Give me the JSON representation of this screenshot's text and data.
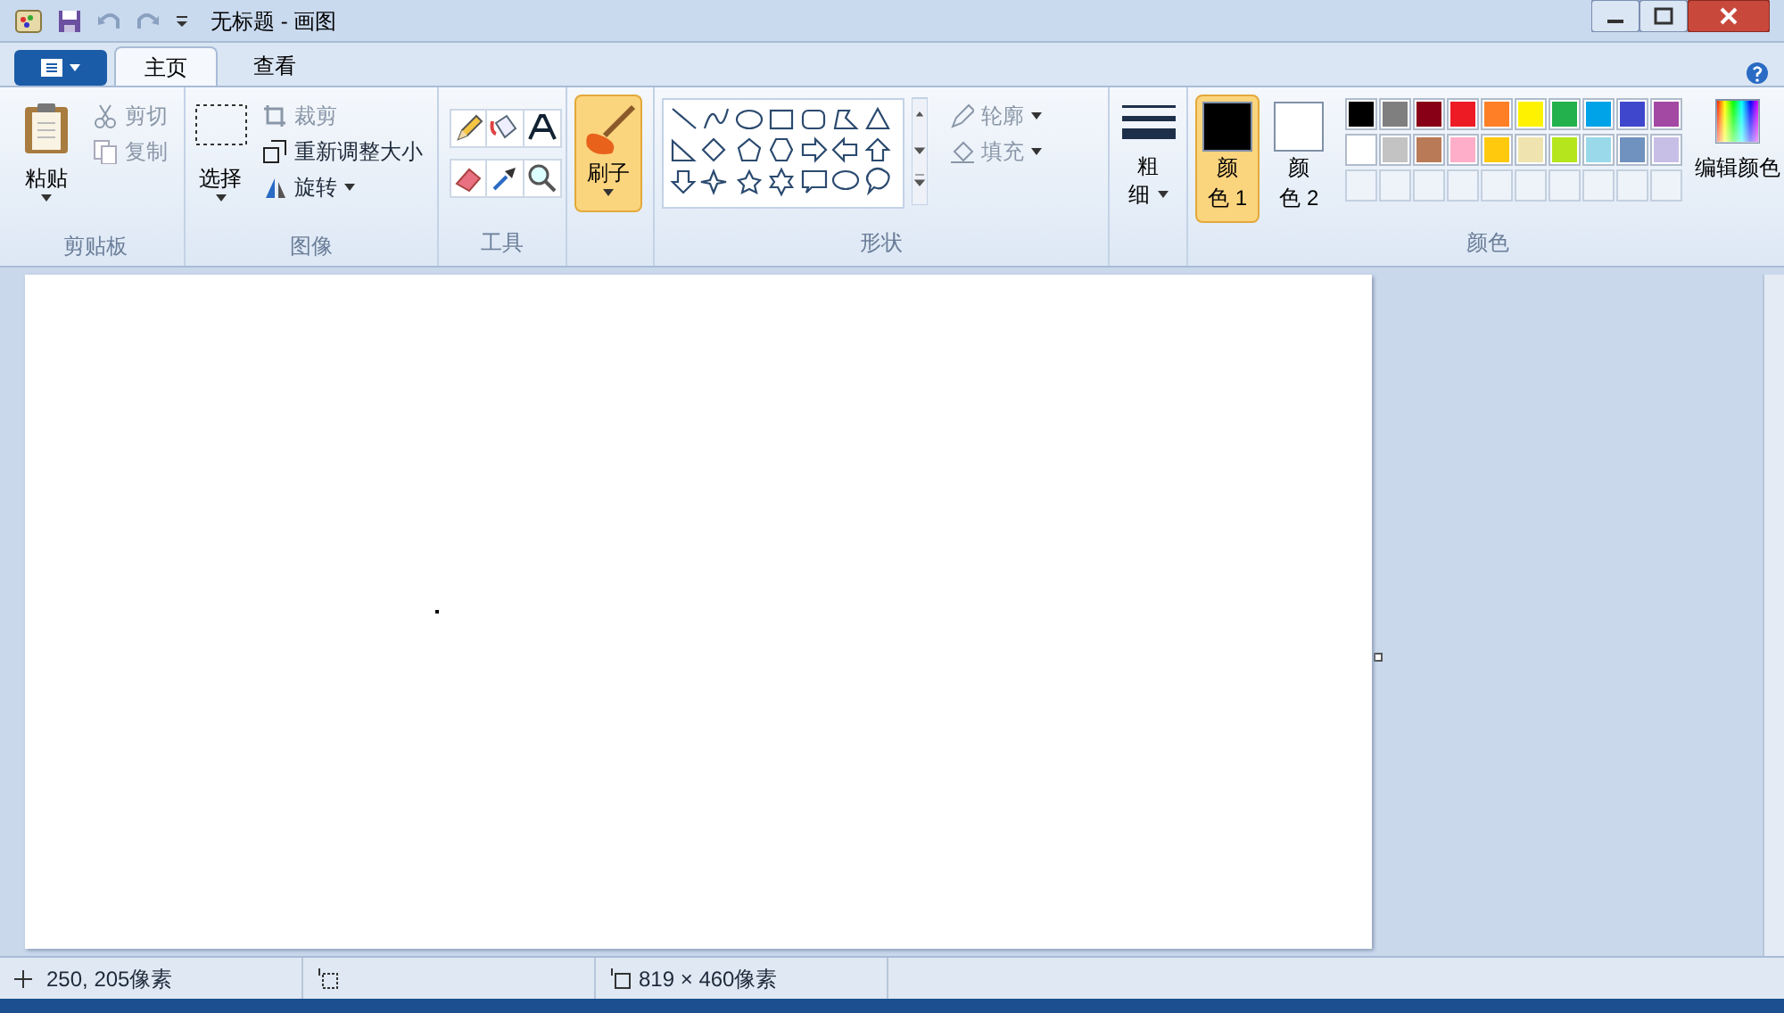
{
  "window": {
    "title": "无标题 - 画图"
  },
  "tabs": [
    {
      "label": "主页",
      "selected": true
    },
    {
      "label": "查看",
      "selected": false
    }
  ],
  "clipboard": {
    "paste": "粘贴",
    "cut": "剪切",
    "copy": "复制",
    "label": "剪贴板"
  },
  "image": {
    "select": "选择",
    "crop": "裁剪",
    "resize": "重新调整大小",
    "rotate": "旋转",
    "label": "图像"
  },
  "tools": {
    "label": "工具"
  },
  "brushes": {
    "label": "刷子",
    "selected": true
  },
  "shapes": {
    "outline": "轮廓",
    "fill": "填充",
    "label": "形状"
  },
  "size": {
    "label_lines": [
      "粗",
      "细"
    ]
  },
  "colors": {
    "color1": {
      "label_lines": [
        "颜",
        "色 1"
      ],
      "color": "#000000",
      "selected": true
    },
    "color2": {
      "label_lines": [
        "颜",
        "色 2"
      ],
      "color": "#ffffff",
      "selected": false
    },
    "palette": [
      {
        "color": "#000000"
      },
      {
        "color": "#7f7f7f"
      },
      {
        "color": "#880015"
      },
      {
        "color": "#ed1c24"
      },
      {
        "color": "#ff7f27"
      },
      {
        "color": "#fff200"
      },
      {
        "color": "#22b14c"
      },
      {
        "color": "#00a2e8"
      },
      {
        "color": "#3f48cc"
      },
      {
        "color": "#a349a4"
      },
      {
        "color": "#ffffff"
      },
      {
        "color": "#c3c3c3"
      },
      {
        "color": "#b97a57"
      },
      {
        "color": "#ffaec9"
      },
      {
        "color": "#ffc90e"
      },
      {
        "color": "#efe4b0"
      },
      {
        "color": "#b5e61d"
      },
      {
        "color": "#99d9ea"
      },
      {
        "color": "#7092be"
      },
      {
        "color": "#c8bfe7"
      }
    ],
    "edit": "编辑颜色",
    "label": "颜色"
  },
  "status_bar": {
    "cursor": "250, 205像素",
    "size": "819 × 460像素"
  }
}
